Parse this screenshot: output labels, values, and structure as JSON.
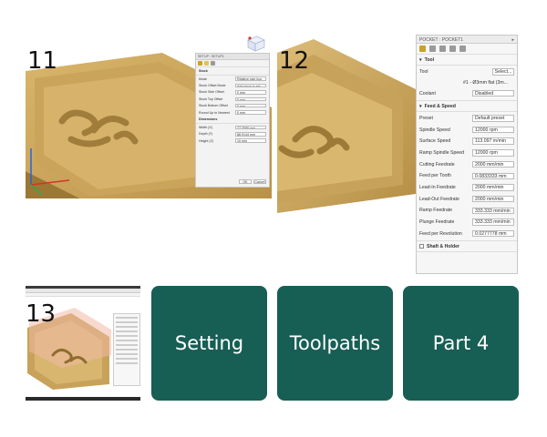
{
  "steps": {
    "s11": "11",
    "s12": "12",
    "s13": "13"
  },
  "setup_dialog": {
    "title": "SETUP : SETUP1",
    "section_stock": "Stock",
    "rows": [
      {
        "label": "Mode",
        "value": "Relative size box"
      },
      {
        "label": "Stock Offset Mode",
        "value": "Add stock to sid..."
      },
      {
        "label": "Stock Side Offset",
        "value": "0 mm"
      },
      {
        "label": "Stock Top Offset",
        "value": "0 mm"
      },
      {
        "label": "Stock Bottom Offset",
        "value": "0 mm"
      },
      {
        "label": "Round Up to Nearest",
        "value": "0 mm"
      }
    ],
    "section_dimensions": "Dimensions",
    "dims": [
      {
        "label": "Width (X)",
        "value": "77.3586 mm"
      },
      {
        "label": "Depth (Y)",
        "value": "88.9144 mm"
      },
      {
        "label": "Height (Z)",
        "value": "10 mm"
      }
    ],
    "ok": "OK",
    "cancel": "Cancel"
  },
  "pocket_dialog": {
    "title": "POCKET : POCKET1",
    "section_tool": "Tool",
    "tool_label": "Tool",
    "tool_button": "Select...",
    "tool_desc": "#1 - Ø3mm flat (3m...",
    "coolant_label": "Coolant",
    "coolant_value": "Disabled",
    "section_feed": "Feed & Speed",
    "rows": [
      {
        "label": "Preset",
        "value": "Default preset"
      },
      {
        "label": "Spindle Speed",
        "value": "12000 rpm"
      },
      {
        "label": "Surface Speed",
        "value": "113.097 m/min"
      },
      {
        "label": "Ramp Spindle Speed",
        "value": "12000 rpm"
      },
      {
        "label": "Cutting Feedrate",
        "value": "2000 mm/min"
      },
      {
        "label": "Feed per Tooth",
        "value": "0.0833333 mm"
      },
      {
        "label": "Lead-In Feedrate",
        "value": "2000 mm/min"
      },
      {
        "label": "Lead-Out Feedrate",
        "value": "2000 mm/min"
      },
      {
        "label": "Ramp Feedrate",
        "value": "333.333 mm/min"
      },
      {
        "label": "Plunge Feedrate",
        "value": "333.333 mm/min"
      },
      {
        "label": "Feed per Revolution",
        "value": "0.0277778 mm"
      }
    ],
    "section_shaft": "Shaft & Holder"
  },
  "tiles": [
    "Setting",
    "Toolpaths",
    "Part 4"
  ],
  "colors": {
    "tile": "#175e54",
    "wood": "#d8b46a",
    "wood_dark": "#a9853f"
  }
}
